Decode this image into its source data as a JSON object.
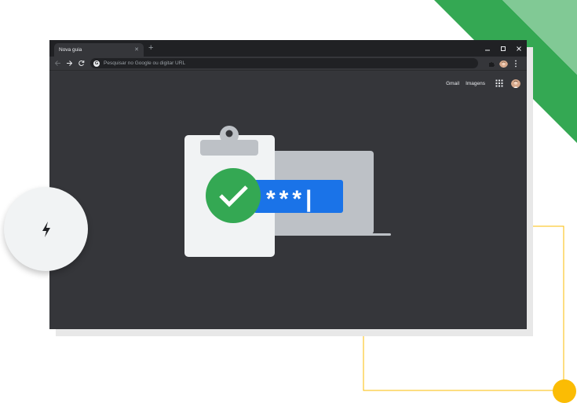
{
  "browser": {
    "tab": {
      "title": "Nova guia",
      "close_icon": "close-icon"
    },
    "new_tab_icon": "plus-icon",
    "window_controls": [
      "minimize-icon",
      "maximize-icon",
      "close-icon"
    ],
    "omnibox": {
      "placeholder": "Pesquisar no Google ou digitar URL",
      "badge": "G"
    },
    "page": {
      "links": {
        "gmail": "Gmail",
        "images": "Imagens"
      },
      "apps_icon": "apps-grid-icon"
    }
  },
  "illustration": {
    "password_mask": "***|"
  },
  "decor": {
    "bolt_icon": "lightning-bolt-icon"
  },
  "colors": {
    "chrome_dark": "#35363a",
    "titlebar": "#202124",
    "google_blue": "#1a73e8",
    "google_green": "#34a853",
    "google_yellow": "#fbbc04",
    "stripe_light_green": "#81c995"
  }
}
